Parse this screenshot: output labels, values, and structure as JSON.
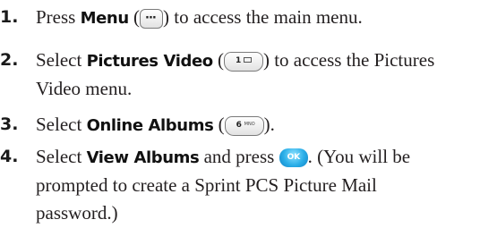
{
  "steps": [
    {
      "number": "1.",
      "text_before": "Press ",
      "keyword": "Menu",
      "text_mid": " (",
      "key_icon": "menu-key-icon",
      "text_after": ") to access the main menu."
    },
    {
      "number": "2.",
      "text_before": "Select ",
      "keyword": "Pictures Video",
      "text_mid": " (",
      "key_icon": "key-1-icon",
      "key_label": "1",
      "text_after": ") to access the Pictures",
      "line2": "Video menu."
    },
    {
      "number": "3.",
      "text_before": "Select ",
      "keyword": "Online Albums",
      "text_mid": " (",
      "key_icon": "key-6-mno-icon",
      "key_label": "6",
      "key_sub": "MNO",
      "text_after": ")."
    },
    {
      "number": "4.",
      "text_before": "Select ",
      "keyword": "View Albums",
      "text_mid": " and press ",
      "key_icon": "ok-key-icon",
      "key_label": "OK",
      "text_after": ". (You will be",
      "line2": "prompted to create a Sprint PCS Picture Mail",
      "line3": "password.)"
    }
  ]
}
